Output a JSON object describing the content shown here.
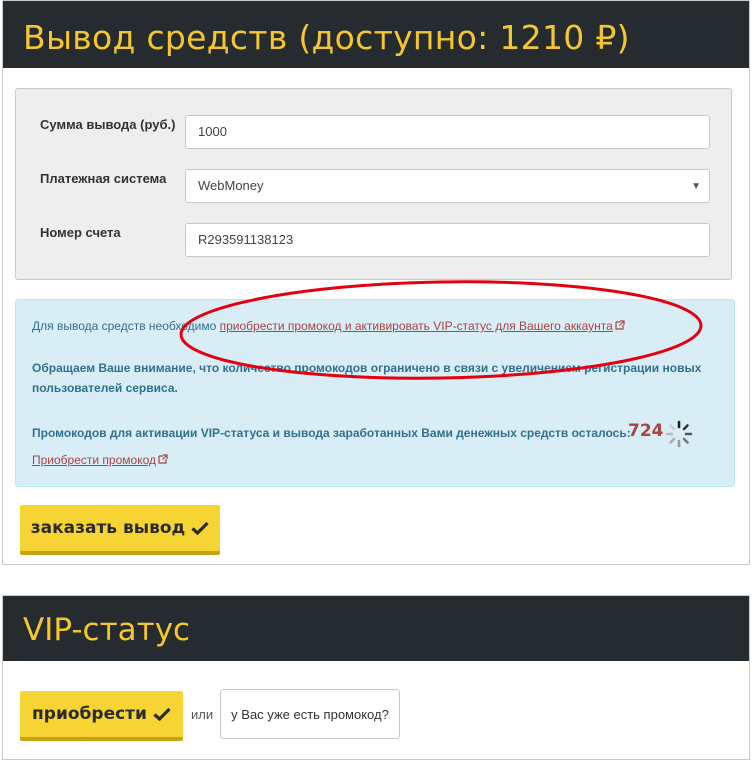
{
  "withdraw": {
    "title": "Вывод средств (доступно: 1210 ₽)",
    "amount_label": "Сумма вывода (руб.)",
    "amount_value": "1000",
    "payment_label": "Платежная система",
    "payment_value": "WebMoney",
    "account_label": "Номер счета",
    "account_value": "R293591138123",
    "info_prefix": "Для вывода средств необходимо ",
    "info_link": "приобрести промокод и активировать VIP-статус для Вашего аккаунта",
    "warning": "Обращаем Ваше внимание, что количество промокодов ограничено в связи с увеличением регистрации новых пользователей сервиса.",
    "remaining_text": "Промокодов для активации VIP-статуса и вывода заработанных Вами денежных средств осталось:",
    "remaining_count": "724",
    "buy_promo_link": "Приобрести промокод",
    "order_button": "заказать вывод"
  },
  "vip": {
    "title": "VIP-статус",
    "buy_button": "приобрести",
    "or_text": "или",
    "have_promo_button": "у Вас уже есть промокод?"
  },
  "colors": {
    "header_bg": "#262b30",
    "header_text": "#f6c72d",
    "button_yellow": "#f6d433",
    "info_bg": "#d9edf7",
    "link_red": "#a94442",
    "annotation_red": "#e3000f"
  },
  "icons": [
    "external-link-icon",
    "spinner-icon",
    "check-icon",
    "caret-down-icon"
  ]
}
